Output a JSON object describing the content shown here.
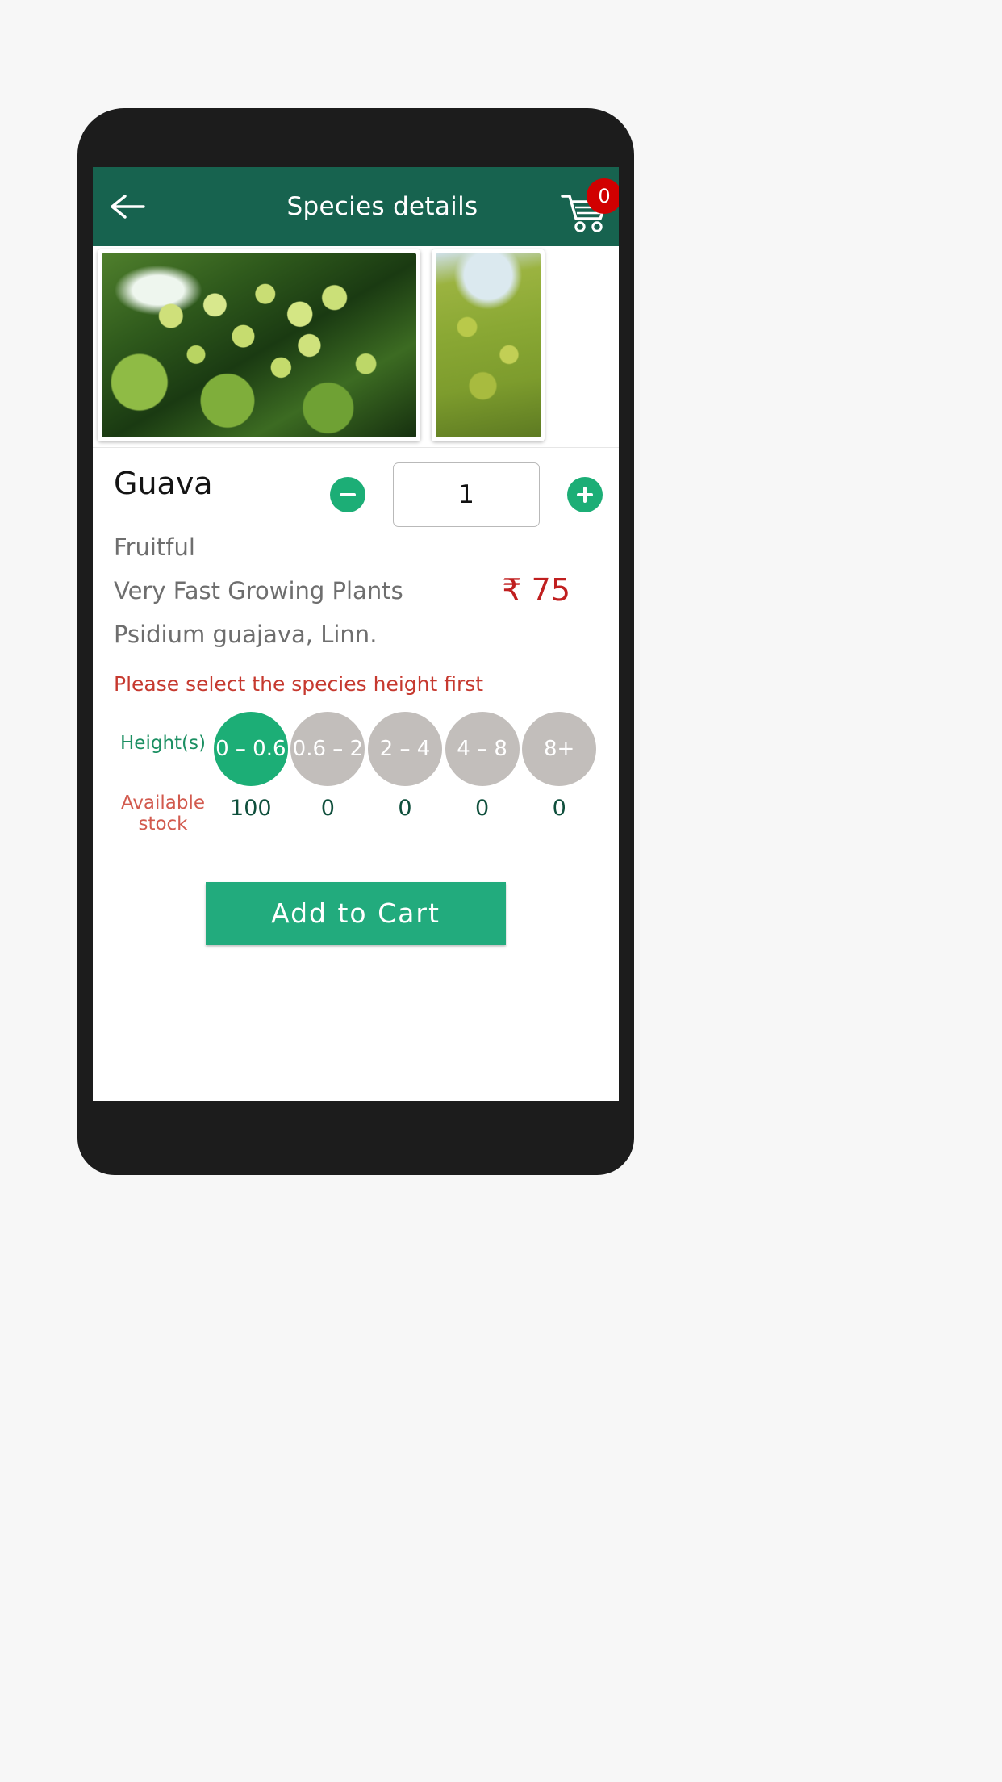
{
  "appbar": {
    "title": "Species details",
    "back_icon": "arrow-left-icon",
    "cart_icon": "shopping-cart-icon",
    "cart_count": "0",
    "background_color": "#17634f"
  },
  "carousel": {
    "images": [
      {
        "alt": "guava-fruit-on-tree"
      },
      {
        "alt": "guava-shrub"
      }
    ]
  },
  "product": {
    "name": "Guava",
    "category": "Fruitful",
    "growth": "Very Fast Growing Plants",
    "botanical_name": "Psidium guajava, Linn.",
    "price": "₹ 75",
    "price_color": "#c01f1f"
  },
  "quantity": {
    "decrement_icon": "minus-icon",
    "increment_icon": "plus-icon",
    "value": "1"
  },
  "warning": {
    "text": "Please select the species height first",
    "color": "#c6392f"
  },
  "heights": {
    "row_label": "Height(s)",
    "stock_label": "Available stock",
    "options": [
      {
        "label": "0 – 0.6",
        "selected": true,
        "stock": "100"
      },
      {
        "label": "0.6 – 2",
        "selected": false,
        "stock": "0"
      },
      {
        "label": "2 – 4",
        "selected": false,
        "stock": "0"
      },
      {
        "label": "4 – 8",
        "selected": false,
        "stock": "0"
      },
      {
        "label": "8+",
        "selected": false,
        "stock": "0"
      }
    ],
    "selected_color": "#1cae76",
    "unselected_color": "#c2bebb"
  },
  "actions": {
    "add_to_cart_label": "Add to Cart",
    "add_to_cart_color": "#22ab7d"
  }
}
